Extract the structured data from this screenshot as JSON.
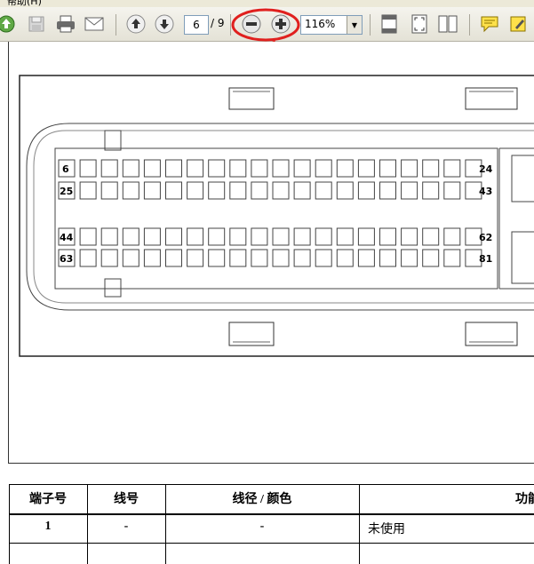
{
  "menubar": {
    "label": "帮助(H)"
  },
  "toolbar": {
    "page_current": "6",
    "page_total": "/ 9",
    "zoom": "116%",
    "icons": [
      "upload-icon",
      "save-icon",
      "print-icon",
      "email-icon",
      "prev-page-icon",
      "next-page-icon",
      "zoom-out-icon",
      "zoom-in-icon",
      "fit-page-icon",
      "fit-width-icon",
      "two-page-icon",
      "comment-icon",
      "highlight-icon"
    ]
  },
  "diagram": {
    "pin_labels": {
      "tl1": "6",
      "tl2": "25",
      "tr1": "24",
      "tr2": "43",
      "bl1": "44",
      "bl2": "63",
      "br1": "62",
      "br2": "81"
    }
  },
  "table": {
    "headers": [
      "端子号",
      "线号",
      "线径 / 颜色",
      "功能"
    ],
    "rows": [
      [
        "1",
        "-",
        "-",
        "未使用"
      ]
    ]
  },
  "annotation": {
    "color": "#e0201e"
  }
}
